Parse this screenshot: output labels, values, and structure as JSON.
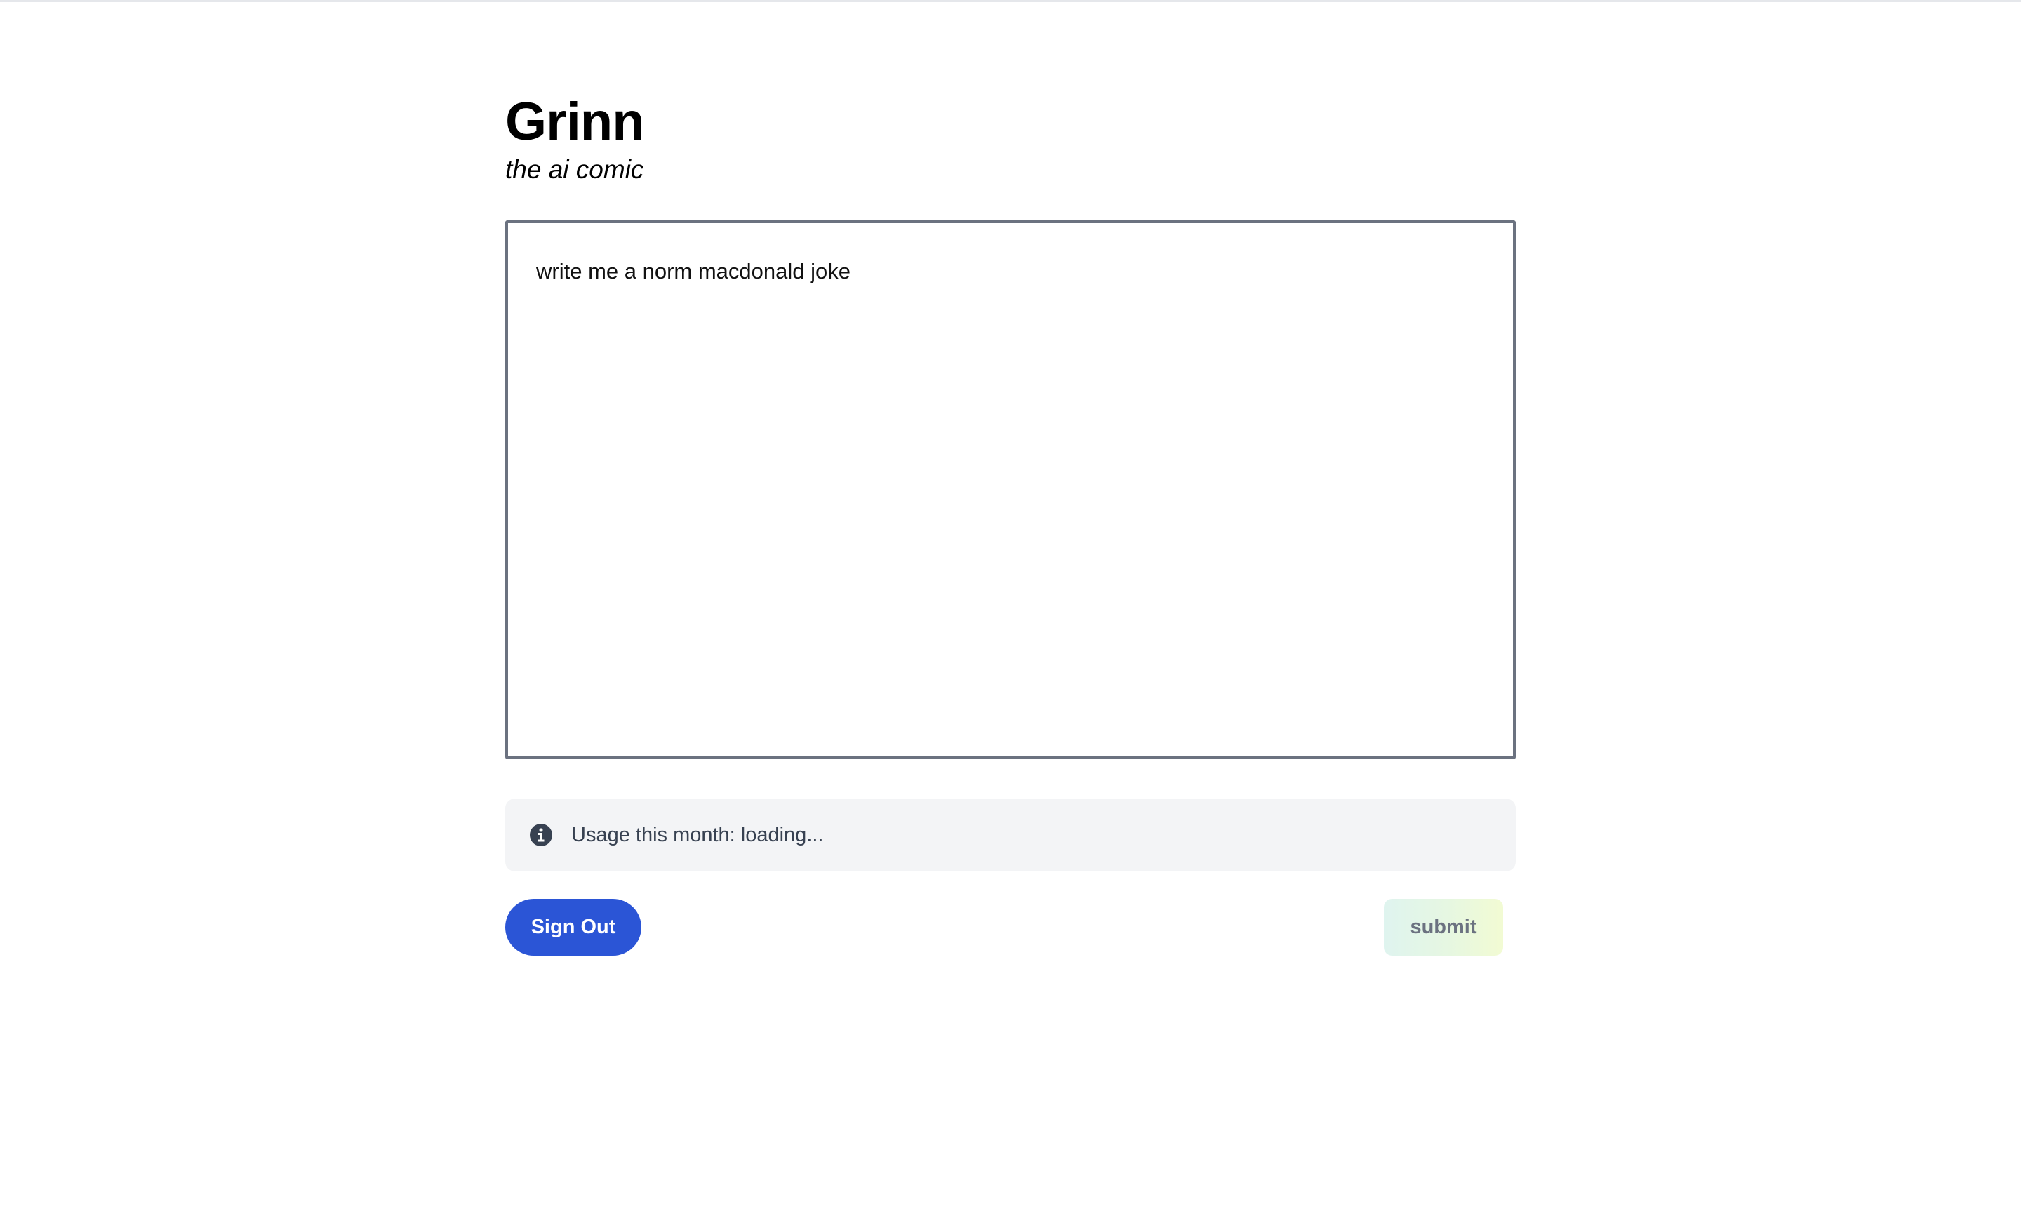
{
  "header": {
    "title": "Grinn",
    "subtitle": "the ai comic"
  },
  "prompt": {
    "value": "write me a norm macdonald joke",
    "placeholder": ""
  },
  "usage": {
    "icon": "info-icon",
    "text": "Usage this month: loading..."
  },
  "actions": {
    "signout_label": "Sign Out",
    "submit_label": "submit"
  },
  "colors": {
    "primary_button": "#2b55d6",
    "textarea_border": "#6b7280",
    "usage_background": "#f3f4f6",
    "submit_gradient_start": "#dff4ef",
    "submit_gradient_end": "#f2fbd3"
  }
}
